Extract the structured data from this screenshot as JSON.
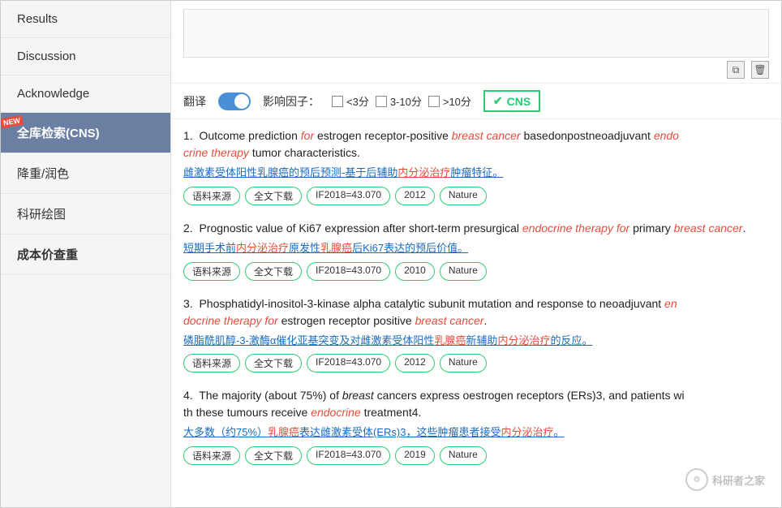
{
  "sidebar": {
    "items": [
      {
        "id": "results",
        "label": "Results",
        "active": false,
        "new": false
      },
      {
        "id": "discussion",
        "label": "Discussion",
        "active": false,
        "new": false
      },
      {
        "id": "acknowledge",
        "label": "Acknowledge",
        "active": false,
        "new": false
      },
      {
        "id": "fullsearch",
        "label": "全库检索(CNS)",
        "active": true,
        "new": true
      },
      {
        "id": "reduce",
        "label": "降重/润色",
        "active": false,
        "new": false
      },
      {
        "id": "drawing",
        "label": "科研绘图",
        "active": false,
        "new": false
      },
      {
        "id": "cost",
        "label": "成本价查重",
        "active": false,
        "new": false
      }
    ]
  },
  "filterBar": {
    "translateLabel": "翻译",
    "ifLabel": "影响因子：",
    "filter1": "<3分",
    "filter2": "3-10分",
    "filter3": ">10分",
    "cnsLabel": "CNS"
  },
  "results": [
    {
      "index": 1,
      "title_parts": "Outcome prediction for estrogen receptor-positive breast cancer basedonpostneoadjuvant endocrine therapy tumor characteristics.",
      "chinese": "雌激素受体阳性乳腺癌的预后预测-基于后辅助内分泌治疗肿瘤特征。",
      "tags": [
        "语料来源",
        "全文下载",
        "IF2018=43.070",
        "2012",
        "Nature"
      ]
    },
    {
      "index": 2,
      "title_parts": "Prognostic value of Ki67 expression after short-term presurgical endocrine therapy for primary breast cancer.",
      "chinese": "短期手术前内分泌治疗原发性乳腺癌后Ki67表达的预后价值。",
      "tags": [
        "语料来源",
        "全文下载",
        "IF2018=43.070",
        "2010",
        "Nature"
      ]
    },
    {
      "index": 3,
      "title_parts": "Phosphatidyl-inositol-3-kinase alpha catalytic subunit mutation and response to neoadjuvant endocrine therapy for estrogen receptor positive breast cancer.",
      "chinese": "磷脂酰肌醇-3-激酶α催化亚基突变及对雌激素受体阳性乳腺癌新辅助内分泌治疗的反应。",
      "tags": [
        "语料来源",
        "全文下载",
        "IF2018=43.070",
        "2012",
        "Nature"
      ]
    },
    {
      "index": 4,
      "title_parts": "The majority (about 75%) of breast cancers express oestrogen receptors (ERs)3, and patients with these tumours receive endocrine treatment4.",
      "chinese": "大多数（约75%）乳腺癌表达雌激素受体(ERs)3，这些肿瘤患者接受内分泌治疗。",
      "tags": [
        "语料来源",
        "全文下载",
        "IF2018=43.070",
        "2019",
        "Nature"
      ]
    }
  ],
  "icons": {
    "copy": "⧉",
    "trash": "🗑"
  },
  "watermark": "科研者之家"
}
